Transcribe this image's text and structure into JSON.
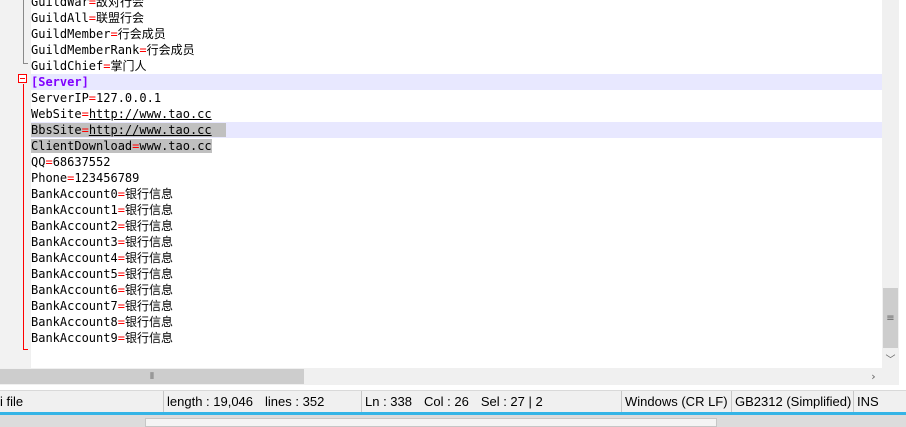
{
  "editor": {
    "lines": [
      {
        "key": "GuildWar",
        "value": "敌对行会"
      },
      {
        "key": "GuildAll",
        "value": "联盟行会"
      },
      {
        "key": "GuildMember",
        "value": "行会成员"
      },
      {
        "key": "GuildMemberRank",
        "value": "行会成员"
      },
      {
        "key": "GuildChief",
        "value": "掌门人"
      },
      {
        "section": "[Server]"
      },
      {
        "key": "ServerIP",
        "value": "127.0.0.1"
      },
      {
        "key": "WebSite",
        "value": "http://www.tao.cc"
      },
      {
        "key": "BbsSite",
        "value": "http://www.tao.cc"
      },
      {
        "key": "ClientDownload",
        "value": "www.tao.cc"
      },
      {
        "key": "QQ",
        "value": "68637552"
      },
      {
        "key": "Phone",
        "value": "123456789"
      },
      {
        "key": "BankAccount0",
        "value": "银行信息"
      },
      {
        "key": "BankAccount1",
        "value": "银行信息"
      },
      {
        "key": "BankAccount2",
        "value": "银行信息"
      },
      {
        "key": "BankAccount3",
        "value": "银行信息"
      },
      {
        "key": "BankAccount4",
        "value": "银行信息"
      },
      {
        "key": "BankAccount5",
        "value": "银行信息"
      },
      {
        "key": "BankAccount6",
        "value": "银行信息"
      },
      {
        "key": "BankAccount7",
        "value": "银行信息"
      },
      {
        "key": "BankAccount8",
        "value": "银行信息"
      },
      {
        "key": "BankAccount9",
        "value": "银行信息"
      }
    ],
    "eq": "="
  },
  "scrollbar": {
    "grip_icon": "≡",
    "down_icon": "﹀",
    "hgrip_icon": "⦀",
    "right_icon": "›"
  },
  "status": {
    "file_type": "i file",
    "length": "length : 19,046",
    "lines": "lines : 352",
    "ln": "Ln : 338",
    "col": "Col : 26",
    "sel": "Sel : 27 | 2",
    "eol": "Windows (CR LF)",
    "encoding": "GB2312 (Simplified)",
    "mode": "INS"
  },
  "colors": {
    "key": "#000000",
    "operator": "#ff0000",
    "section": "#8000ff",
    "current_line": "#e8e8ff",
    "selection": "#c0c0c0",
    "fold_marker": "#ff0000"
  }
}
